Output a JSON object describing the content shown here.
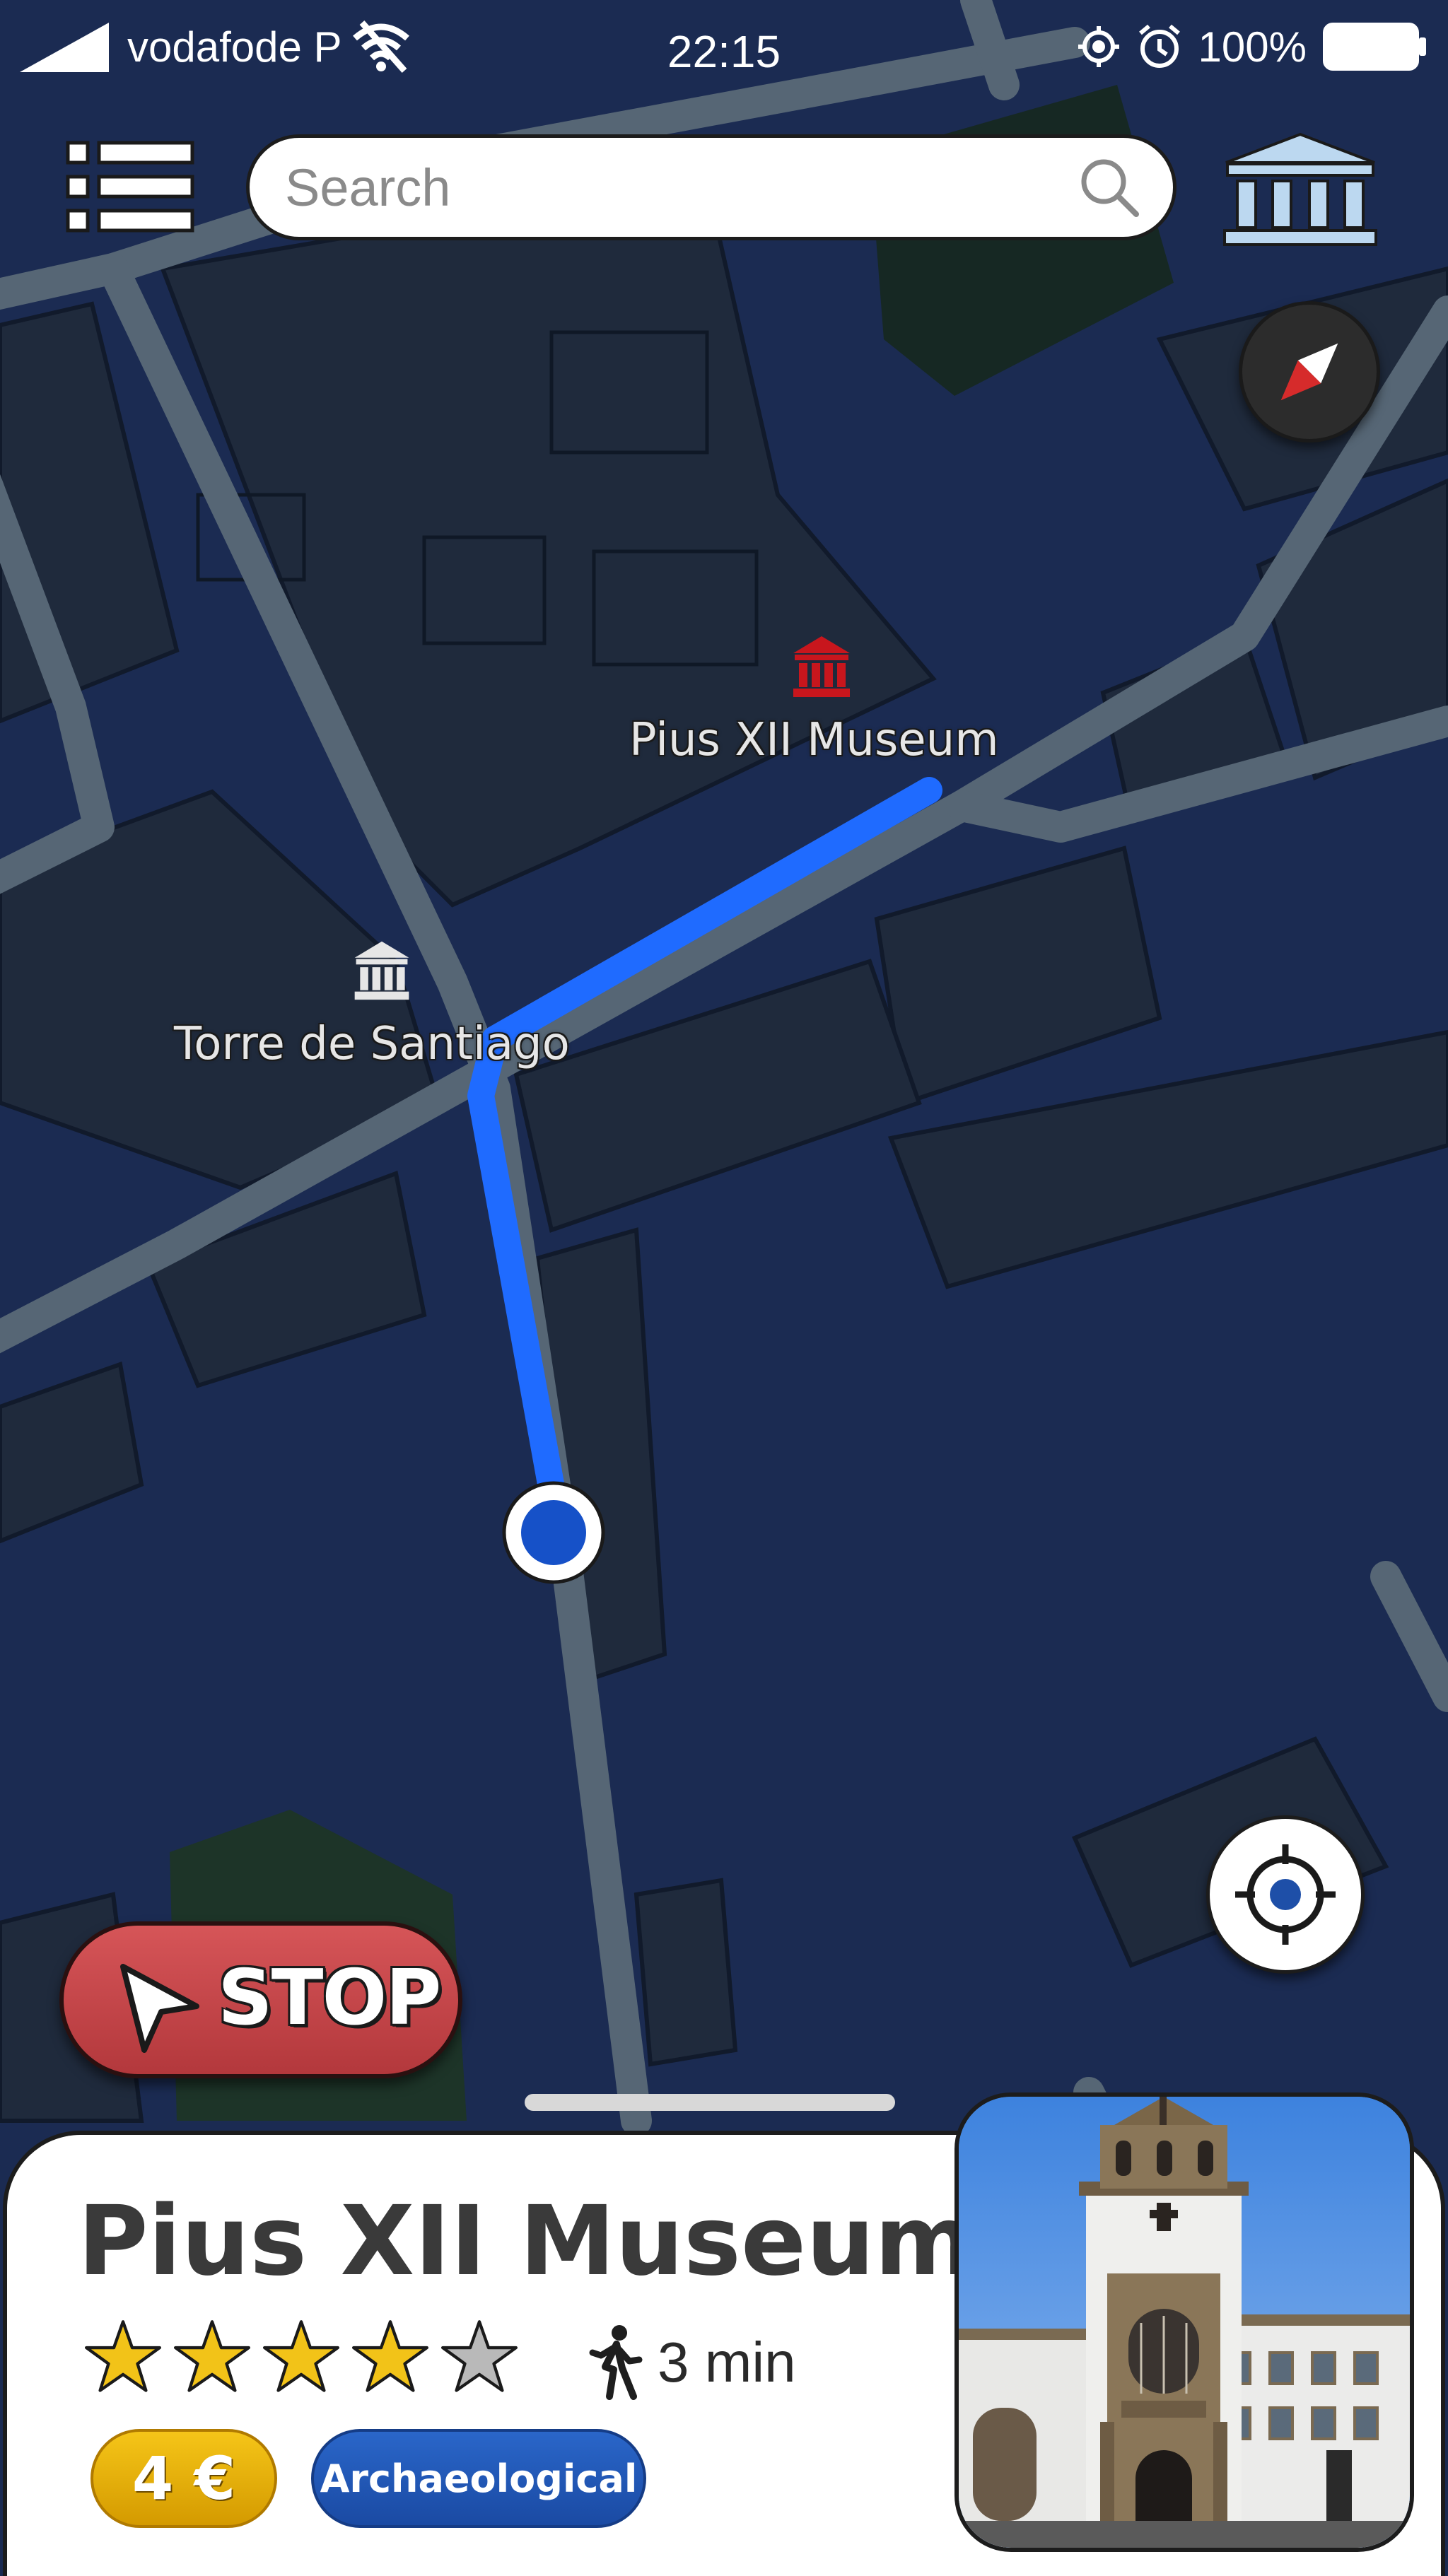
{
  "status_bar": {
    "carrier": "vodafode P",
    "time": "22:15",
    "battery": "100%",
    "icons": [
      "signal-icon",
      "wifi-off-icon",
      "location-icon",
      "alarm-icon",
      "battery-icon"
    ]
  },
  "top_bar": {
    "search_placeholder": "Search",
    "menu_icon": "list-icon",
    "search_icon": "search-icon",
    "category_icon": "museum-icon",
    "compass_icon": "compass-icon"
  },
  "map": {
    "route_color": "#1f6bff",
    "pois": [
      {
        "name": "Pius XII Museum",
        "icon": "museum-icon",
        "color": "#c8161d"
      },
      {
        "name": "Torre de Santiago",
        "icon": "museum-icon",
        "color": "#e8e8e8"
      }
    ],
    "user_location_icon": "user-location-icon",
    "locate_icon": "crosshair-icon"
  },
  "navigation": {
    "stop_label": "STOP",
    "stop_icon": "navigation-arrow-icon",
    "accent": "#c4444a"
  },
  "place_card": {
    "title": "Pius XII Museum",
    "rating": 4,
    "rating_max": 5,
    "walk_time": "3 min",
    "walk_icon": "walking-icon",
    "price": "4 €",
    "category": "Archaeological",
    "price_color": "#f0b400",
    "category_color": "#1f5bbd",
    "photo_icon": "museum-photo"
  }
}
